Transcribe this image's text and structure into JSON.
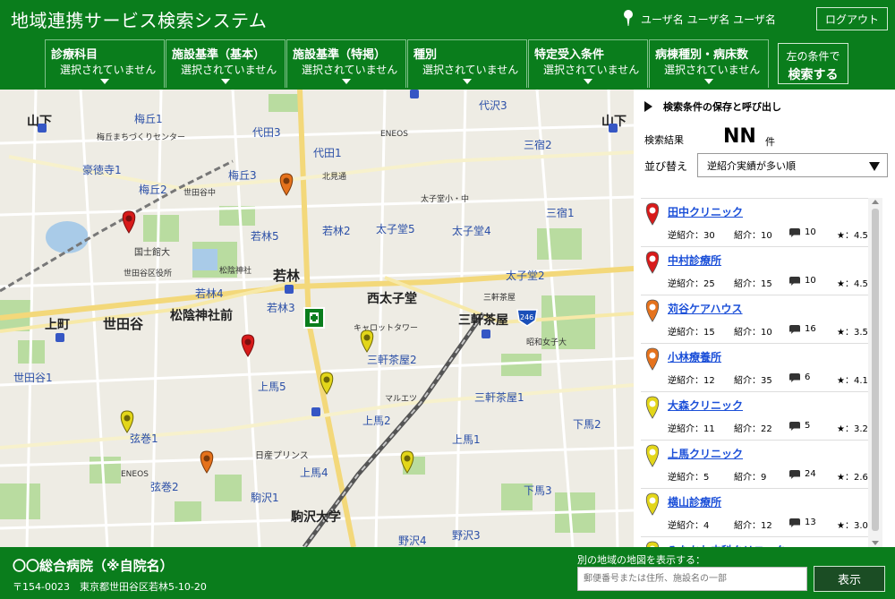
{
  "app": {
    "title": "地域連携サービス検索システム"
  },
  "user": {
    "name": "ユーザ名 ユーザ名 ユーザ名",
    "logout_label": "ログアウト"
  },
  "filters": [
    {
      "title": "診療科目",
      "value": "選択されていません"
    },
    {
      "title": "施設基準（基本）",
      "value": "選択されていません"
    },
    {
      "title": "施設基準（特掲）",
      "value": "選択されていません"
    },
    {
      "title": "種別",
      "value": "選択されていません"
    },
    {
      "title": "特定受入条件",
      "value": "選択されていません"
    },
    {
      "title": "病棟種別・病床数",
      "value": "選択されていません"
    }
  ],
  "search_button": {
    "line1": "左の条件で",
    "line2": "検索する"
  },
  "panel": {
    "saved_conditions_label": "検索条件の保存と呼び出し",
    "result_label": "検索結果",
    "result_count": "NN",
    "result_unit": "件",
    "sort_label": "並び替え",
    "sort_value": "逆紹介実績が多い順"
  },
  "results": [
    {
      "name": "田中クリニック",
      "gyaku": "逆紹介：30",
      "shokai": "紹介：10",
      "comments": "10",
      "rating": "★：4.5",
      "pin_color": "#d81b1b"
    },
    {
      "name": "中村診療所",
      "gyaku": "逆紹介：25",
      "shokai": "紹介：15",
      "comments": "10",
      "rating": "★：4.5",
      "pin_color": "#d81b1b"
    },
    {
      "name": "苅谷ケアハウス",
      "gyaku": "逆紹介：15",
      "shokai": "紹介：10",
      "comments": "16",
      "rating": "★：3.5",
      "pin_color": "#e5721c"
    },
    {
      "name": "小林療養所",
      "gyaku": "逆紹介：12",
      "shokai": "紹介：35",
      "comments": "6",
      "rating": "★：4.1",
      "pin_color": "#e5721c"
    },
    {
      "name": "大森クリニック",
      "gyaku": "逆紹介：11",
      "shokai": "紹介：22",
      "comments": "5",
      "rating": "★：3.2",
      "pin_color": "#e3d61a"
    },
    {
      "name": "上馬クリニック",
      "gyaku": "逆紹介：5",
      "shokai": "紹介：9",
      "comments": "24",
      "rating": "★：2.6",
      "pin_color": "#e3d61a"
    },
    {
      "name": "横山診療所",
      "gyaku": "逆紹介：4",
      "shokai": "紹介：12",
      "comments": "13",
      "rating": "★：3.0",
      "pin_color": "#e3d61a"
    },
    {
      "name": "みなかわ内科クリニック",
      "gyaku": "",
      "shokai": "",
      "comments": "",
      "rating": "",
      "pin_color": "#e3d61a"
    }
  ],
  "map": {
    "labels": [
      {
        "text": "山下",
        "big": true
      },
      {
        "text": "梅丘1"
      },
      {
        "text": "梅丘まちづくりセンター",
        "small": true
      },
      {
        "text": "代田3"
      },
      {
        "text": "ENEOS",
        "small": true
      },
      {
        "text": "代沢3"
      },
      {
        "text": "山下",
        "big": true
      },
      {
        "text": "豪徳寺1"
      },
      {
        "text": "梅丘2"
      },
      {
        "text": "世田谷中",
        "small": true
      },
      {
        "text": "代田1"
      },
      {
        "text": "北見通",
        "small": true
      },
      {
        "text": "三宿2"
      },
      {
        "text": "梅丘3"
      },
      {
        "text": "若林5"
      },
      {
        "text": "若林2"
      },
      {
        "text": "太子堂5"
      },
      {
        "text": "太子堂4"
      },
      {
        "text": "国士館大",
        "small": true
      },
      {
        "text": "松陰神社",
        "small": true
      },
      {
        "text": "世田谷区役所",
        "small": true
      },
      {
        "text": "若林",
        "big": true
      },
      {
        "text": "西太子堂",
        "big": true
      },
      {
        "text": "三軒茶屋",
        "big": true
      },
      {
        "text": "太子堂2"
      },
      {
        "text": "若林4"
      },
      {
        "text": "若林3"
      },
      {
        "text": "上町",
        "big": true
      },
      {
        "text": "世田谷",
        "big": true
      },
      {
        "text": "松陰神社前",
        "big": true
      },
      {
        "text": "三軒茶屋2"
      },
      {
        "text": "三軒茶屋1"
      },
      {
        "text": "上馬5"
      },
      {
        "text": "上馬2"
      },
      {
        "text": "上馬1"
      },
      {
        "text": "弦巻1"
      },
      {
        "text": "弦巻2"
      },
      {
        "text": "駒沢1"
      },
      {
        "text": "上馬4"
      },
      {
        "text": "下馬3"
      },
      {
        "text": "駒沢大学",
        "big": true
      },
      {
        "text": "野沢4"
      },
      {
        "text": "野沢3"
      },
      {
        "text": "日産プリンス",
        "small": true
      },
      {
        "text": "世田谷1"
      },
      {
        "text": "三宿1"
      },
      {
        "text": "昭和女子大",
        "small": true
      },
      {
        "text": "下馬2"
      },
      {
        "text": "太子堂小・中",
        "small": true
      },
      {
        "text": "キャロットタワー",
        "small": true
      },
      {
        "text": "マルエツ",
        "small": true
      },
      {
        "text": "ENEOS",
        "small": true
      },
      {
        "text": "三軒茶屋",
        "small": true
      },
      {
        "text": "246",
        "small": true
      }
    ]
  },
  "footer": {
    "hospital_name": "〇〇総合病院（※自院名）",
    "address": "〒154-0023　東京都世田谷区若林5-10-20",
    "other_area_label": "別の地域の地図を表示する：",
    "search_placeholder": "郵便番号または住所、施設名の一部",
    "show_button": "表示"
  }
}
